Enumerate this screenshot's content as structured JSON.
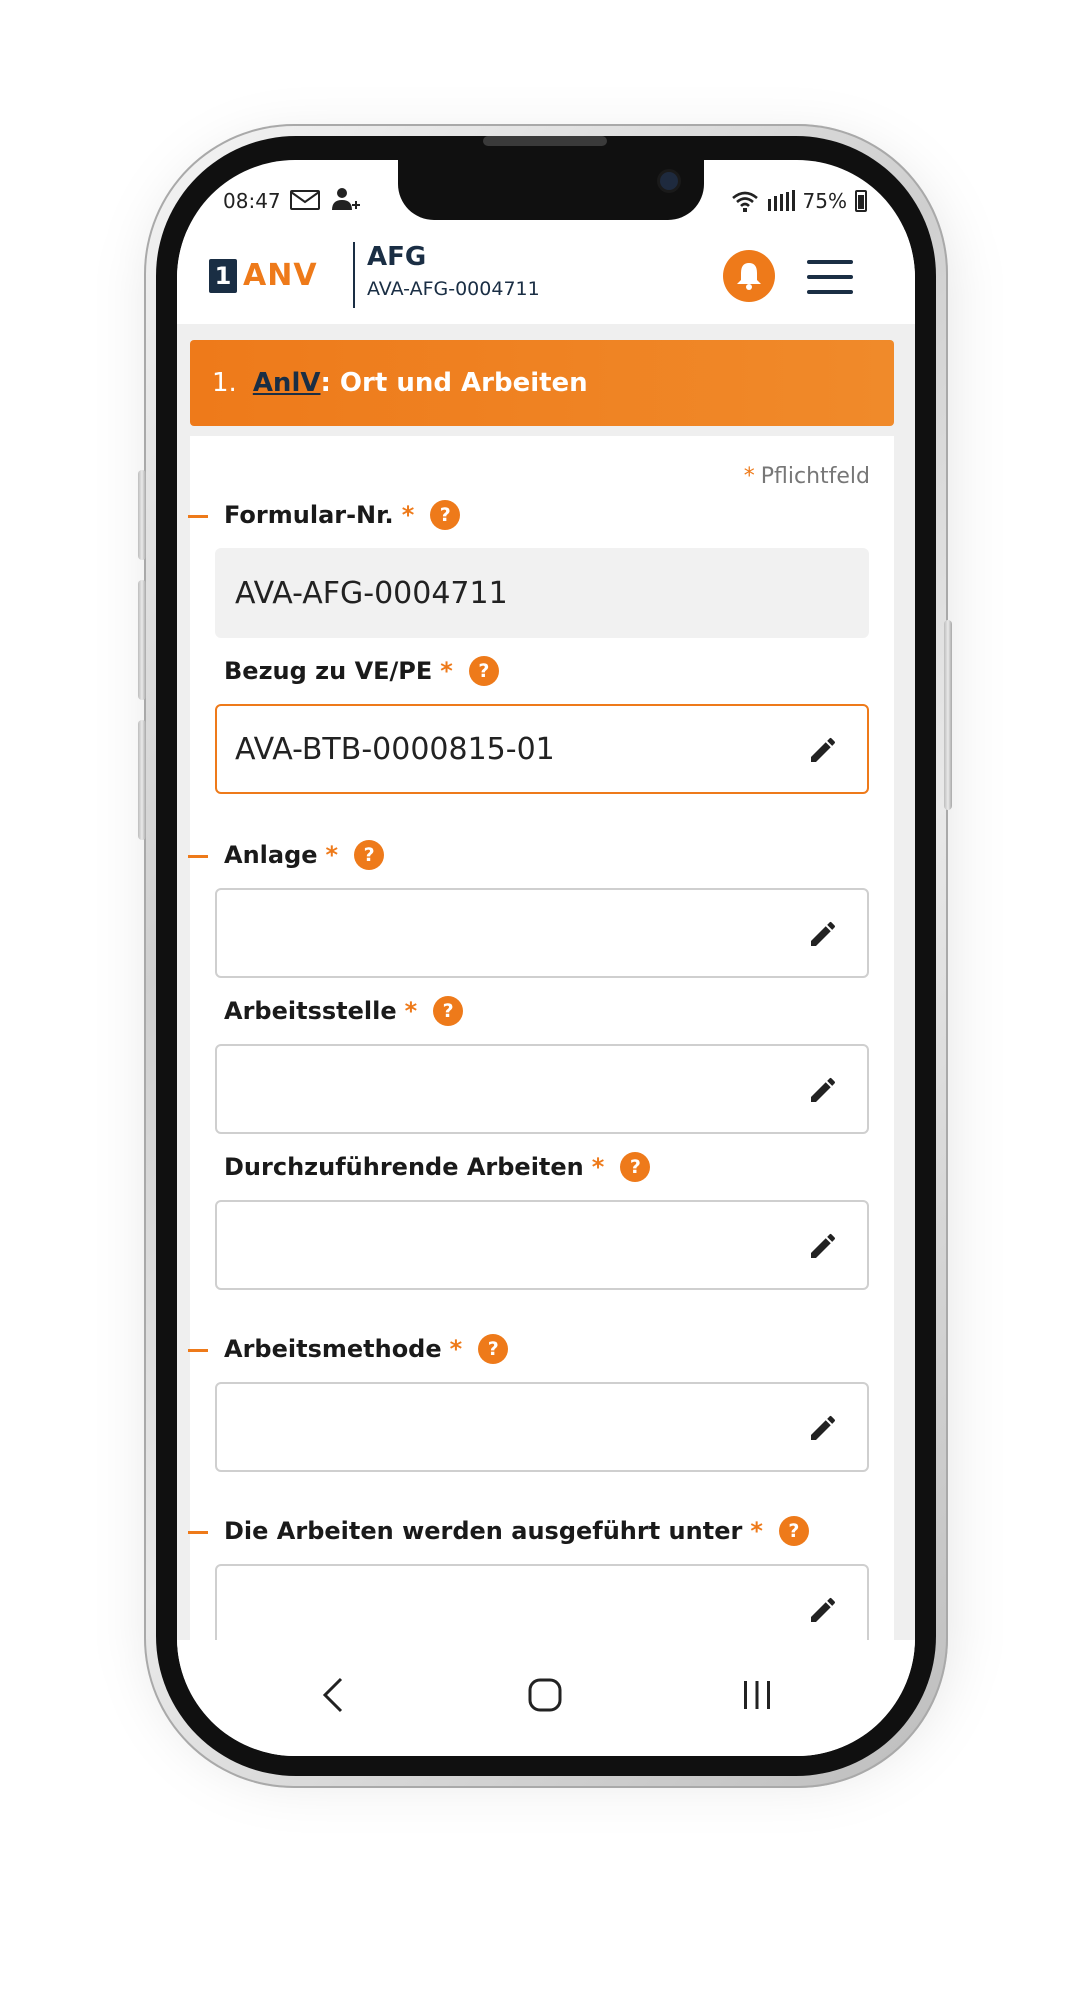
{
  "status_bar": {
    "time": "08:47",
    "battery": "75%"
  },
  "app_header": {
    "logo_number": "1",
    "logo_text": "ANV",
    "title": "AFG",
    "subtitle": "AVA-AFG-0004711"
  },
  "section": {
    "number": "1.",
    "abbr": "AnlV",
    "title_rest": ": Ort und Arbeiten"
  },
  "mandatory_note": {
    "star": "*",
    "label": "Pflichtfeld"
  },
  "fields": [
    {
      "label": "Formular-Nr.",
      "required": "*",
      "help": "?",
      "value": "AVA-AFG-0004711"
    },
    {
      "label": "Bezug zu VE/PE",
      "required": "*",
      "help": "?",
      "value": "AVA-BTB-0000815-01"
    },
    {
      "label": "Anlage",
      "required": "*",
      "help": "?",
      "value": ""
    },
    {
      "label": "Arbeitsstelle",
      "required": "*",
      "help": "?",
      "value": ""
    },
    {
      "label": "Durchzuführende Arbeiten",
      "required": "*",
      "help": "?",
      "value": ""
    },
    {
      "label": "Arbeitsmethode",
      "required": "*",
      "help": "?",
      "value": ""
    },
    {
      "label": "Die Arbeiten werden ausgeführt unter",
      "required": "*",
      "help": "?",
      "value": ""
    }
  ],
  "colors": {
    "accent": "#ee7a1a",
    "brand_dark": "#1a2e44"
  }
}
